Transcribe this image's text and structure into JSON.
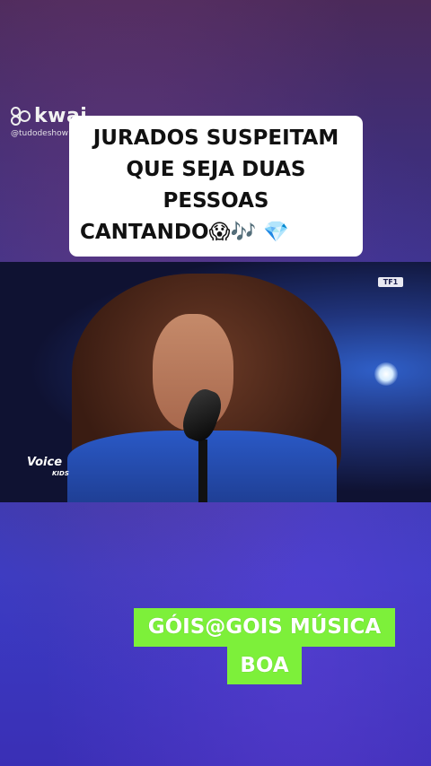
{
  "watermark": {
    "app_name": "kwai",
    "handle": "@tudodeshow"
  },
  "caption": {
    "line1": "JURADOS SUSPEITAM",
    "line2": "QUE SEJA DUAS",
    "line3": "PESSOAS",
    "line4": "CANTANDO😱🎶 💎"
  },
  "video": {
    "channel_logo": "TF1",
    "show_logo": "Voice",
    "show_logo_sub": "KIDS"
  },
  "comment": {
    "line1": "GÓIS@GOIS MÚSICA",
    "line2": "BOA"
  }
}
